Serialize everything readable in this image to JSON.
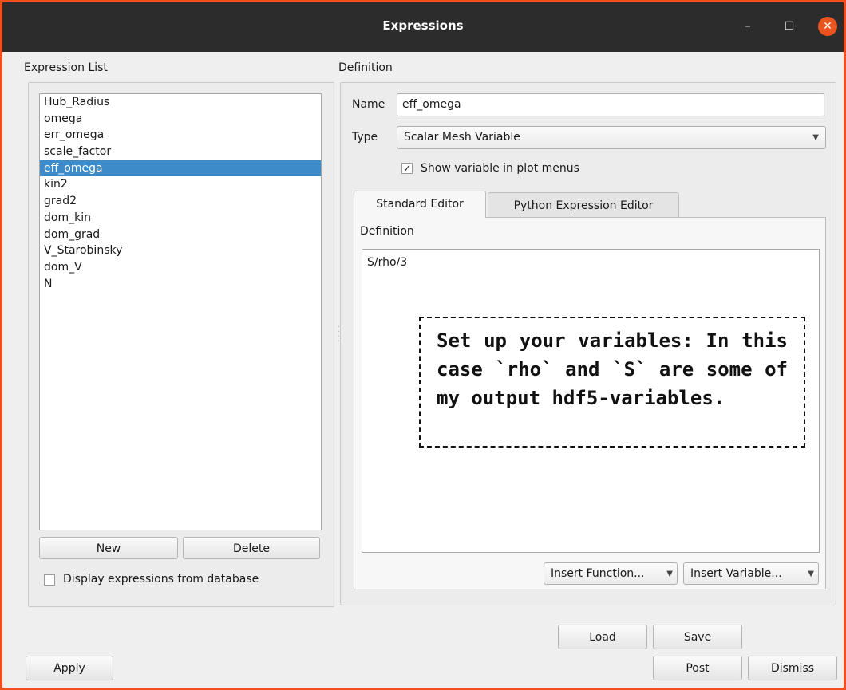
{
  "window": {
    "title": "Expressions",
    "minimize_symbol": "–",
    "maximize_symbol": "☐",
    "close_symbol": "✕"
  },
  "expression_list": {
    "heading": "Expression List",
    "items": [
      "Hub_Radius",
      "omega",
      "err_omega",
      "scale_factor",
      "eff_omega",
      "kin2",
      "grad2",
      "dom_kin",
      "dom_grad",
      "V_Starobinsky",
      "dom_V",
      "N"
    ],
    "selected": "eff_omega",
    "new_label": "New",
    "delete_label": "Delete",
    "display_db_label": "Display expressions from database",
    "display_db_checked": false
  },
  "definition": {
    "heading": "Definition",
    "name_label": "Name",
    "name_value": "eff_omega",
    "type_label": "Type",
    "type_value": "Scalar Mesh Variable",
    "show_in_menus_label": "Show variable in plot menus",
    "show_in_menus_checked": true,
    "tabs": [
      "Standard Editor",
      "Python Expression Editor"
    ],
    "active_tab": "Standard Editor",
    "editor_label": "Definition",
    "editor_text": "S/rho/3",
    "insert_function_label": "Insert Function...",
    "insert_variable_label": "Insert Variable..."
  },
  "annotation": {
    "text": "Set up your variables: In this case `rho` and `S` are some of my output hdf5-variables."
  },
  "bottom": {
    "load_label": "Load",
    "save_label": "Save",
    "apply_label": "Apply",
    "post_label": "Post",
    "dismiss_label": "Dismiss"
  },
  "colors": {
    "frame_border": "#f04e1a",
    "titlebar": "#2c2c2c",
    "selection": "#3d8bc9",
    "close_button": "#e9541f"
  }
}
